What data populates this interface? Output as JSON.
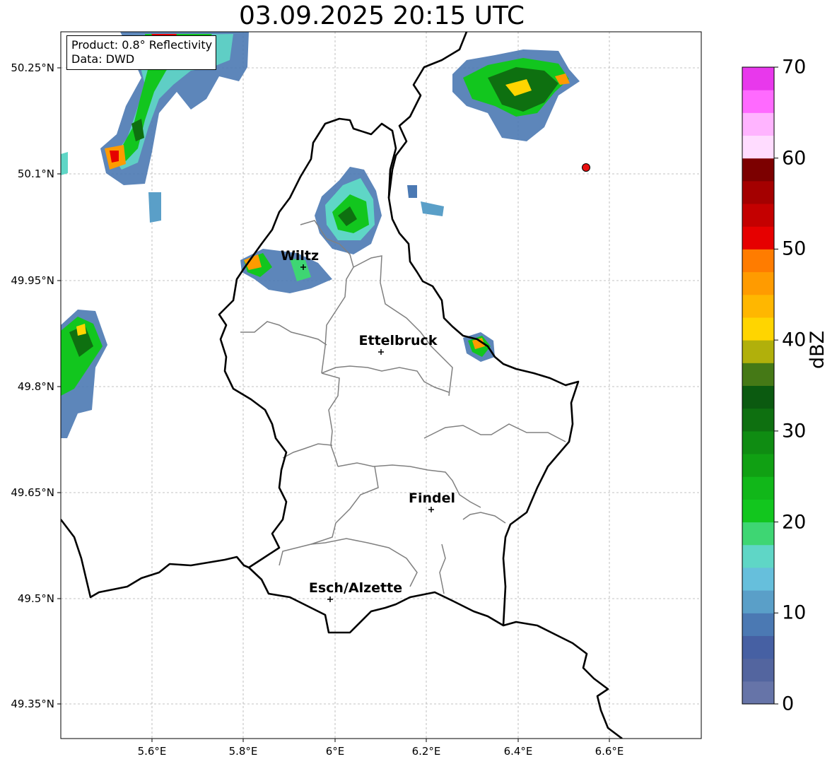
{
  "title": "03.09.2025 20:15 UTC",
  "info": {
    "product": "Product: 0.8° Reflectivity",
    "data": "Data: DWD"
  },
  "lon_ticks": [
    "5.6°E",
    "5.8°E",
    "6°E",
    "6.2°E",
    "6.4°E",
    "6.6°E"
  ],
  "lat_ticks": [
    "50.25°N",
    "50.1°N",
    "49.95°N",
    "49.8°N",
    "49.65°N",
    "49.5°N",
    "49.35°N"
  ],
  "cities": [
    {
      "name": "Wiltz"
    },
    {
      "name": "Ettelbruck"
    },
    {
      "name": "Findel"
    },
    {
      "name": "Esch/Alzette"
    }
  ],
  "colorbar": {
    "label": "dBZ",
    "ticks": [
      "0",
      "10",
      "20",
      "30",
      "40",
      "50",
      "60",
      "70"
    ],
    "range": [
      0,
      70
    ],
    "colors": [
      "#6674a8",
      "#53659f",
      "#4660a3",
      "#4b79b3",
      "#5a9fc8",
      "#66bfdc",
      "#5fd6c6",
      "#3ed673",
      "#12c61e",
      "#11b719",
      "#10a013",
      "#0f8c12",
      "#0e7010",
      "#0b5a10",
      "#457916",
      "#b1b00b",
      "#ffd500",
      "#ffb700",
      "#ff9b00",
      "#ff7c00",
      "#e60000",
      "#c40000",
      "#a40000",
      "#7c0000",
      "#ffdcff",
      "#ffb4ff",
      "#ff6aff",
      "#e838ec"
    ]
  },
  "marker_color": "#e81010"
}
